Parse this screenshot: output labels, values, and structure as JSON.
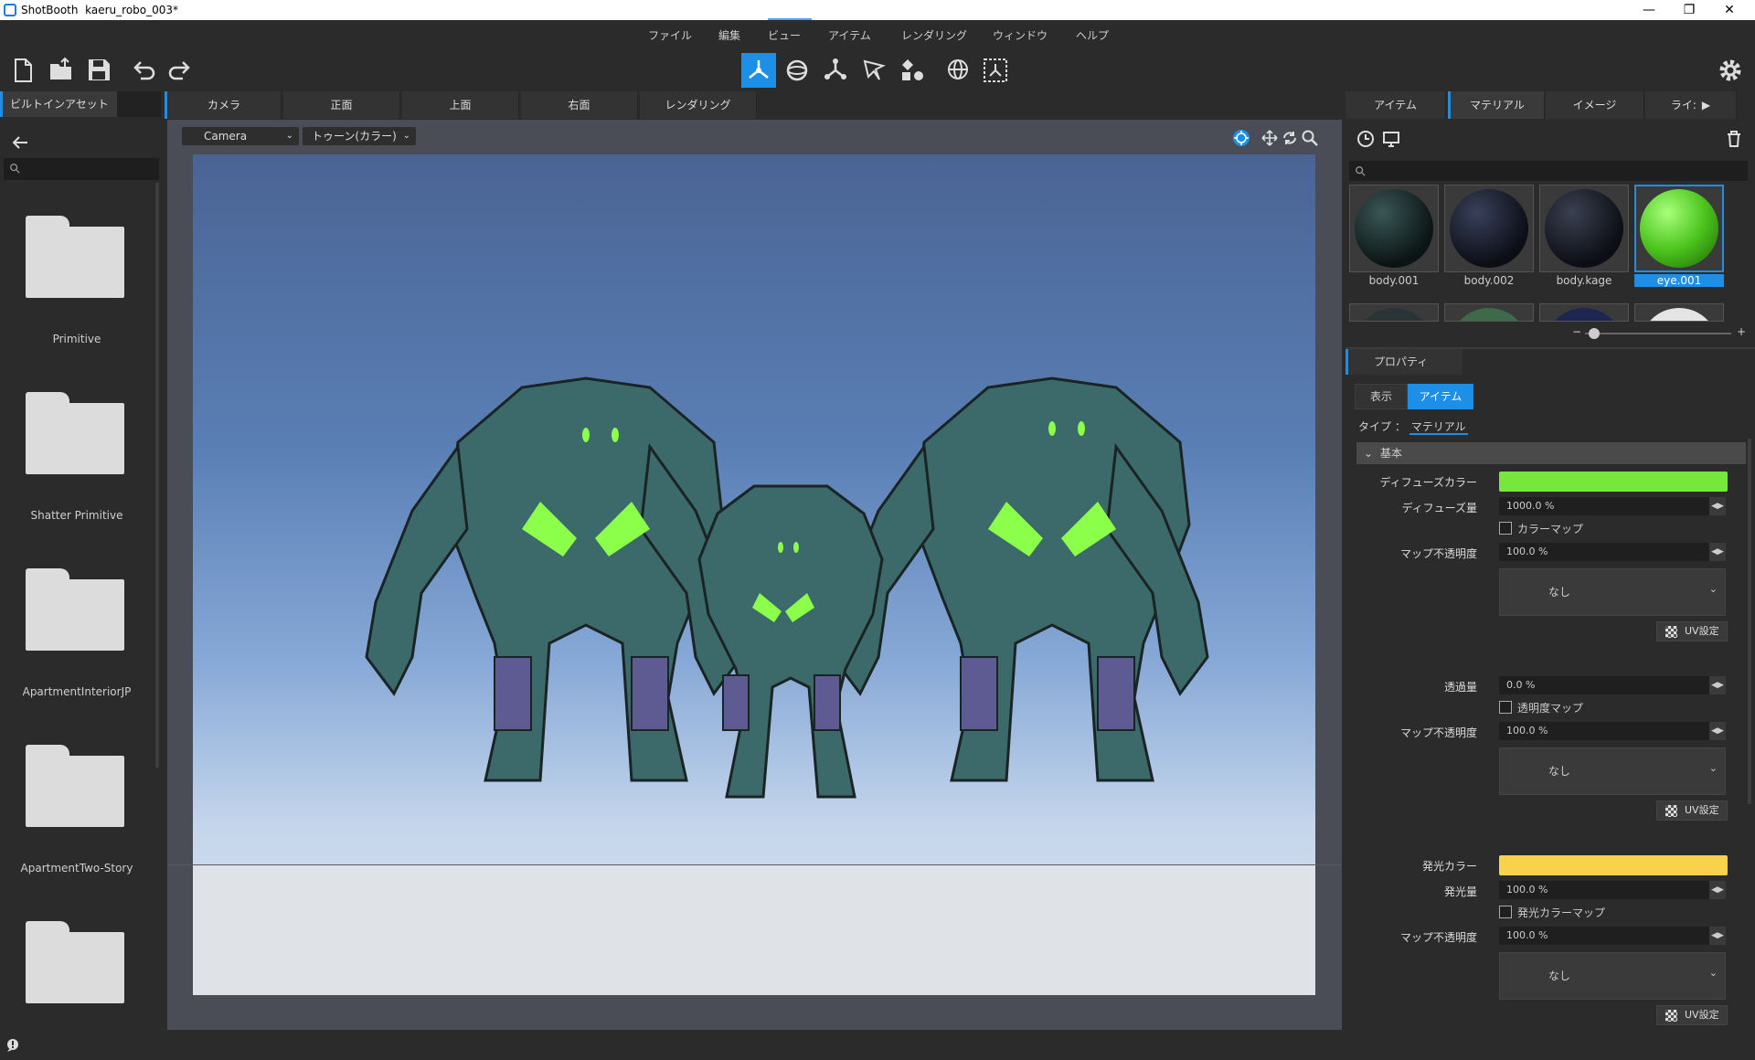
{
  "window": {
    "app": "ShotBooth",
    "file": "kaeru_robo_003*",
    "controls": [
      "—",
      "❐",
      "✕"
    ]
  },
  "menu": [
    "ファイル",
    "編集",
    "ビュー",
    "アイテム",
    "レンダリング",
    "ウィンドウ",
    "ヘルプ"
  ],
  "left_panel": {
    "tab": "ビルトインアセット",
    "folders": [
      "Primitive",
      "Shatter Primitive",
      "ApartmentInteriorJP",
      "ApartmentTwo-Story",
      ""
    ]
  },
  "view_tabs": [
    "カメラ",
    "正面",
    "上面",
    "右面",
    "レンダリング"
  ],
  "viewport": {
    "camera_select": "Camera",
    "shading_select": "トゥーン(カラー)"
  },
  "right_panel": {
    "tabs": [
      "アイテム",
      "マテリアル",
      "イメージ",
      "ライ:"
    ],
    "materials": [
      {
        "name": "body.001",
        "color": "#1e2e30"
      },
      {
        "name": "body.002",
        "color": "#1a2030"
      },
      {
        "name": "body.kage",
        "color": "#1c2028"
      },
      {
        "name": "eye.001",
        "color": "#5fd13a"
      }
    ],
    "properties": {
      "header": "プロパティ",
      "subtabs": [
        "表示",
        "アイテム"
      ],
      "type_label": "タイプ",
      "type_sep": "：",
      "type_value": "マテリアル",
      "section": "基本",
      "diffuse_color_label": "ディフューズカラー",
      "diffuse_color": "#76e83c",
      "diffuse_amount_label": "ディフューズ量",
      "diffuse_amount": "1000.0 %",
      "color_map_label": "カラーマップ",
      "map_opacity_label": "マップ不透明度",
      "map_opacity_1": "100.0 %",
      "none": "なし",
      "uv_label": "UV設定",
      "transparency_label": "透過量",
      "transparency": "0.0 %",
      "transparency_map_label": "透明度マップ",
      "map_opacity_2": "100.0 %",
      "emission_color_label": "発光カラー",
      "emission_color": "#f7d24a",
      "emission_amount_label": "発光量",
      "emission_amount": "100.0 %",
      "emission_map_label": "発光カラーマップ",
      "map_opacity_3": "100.0 %"
    }
  }
}
